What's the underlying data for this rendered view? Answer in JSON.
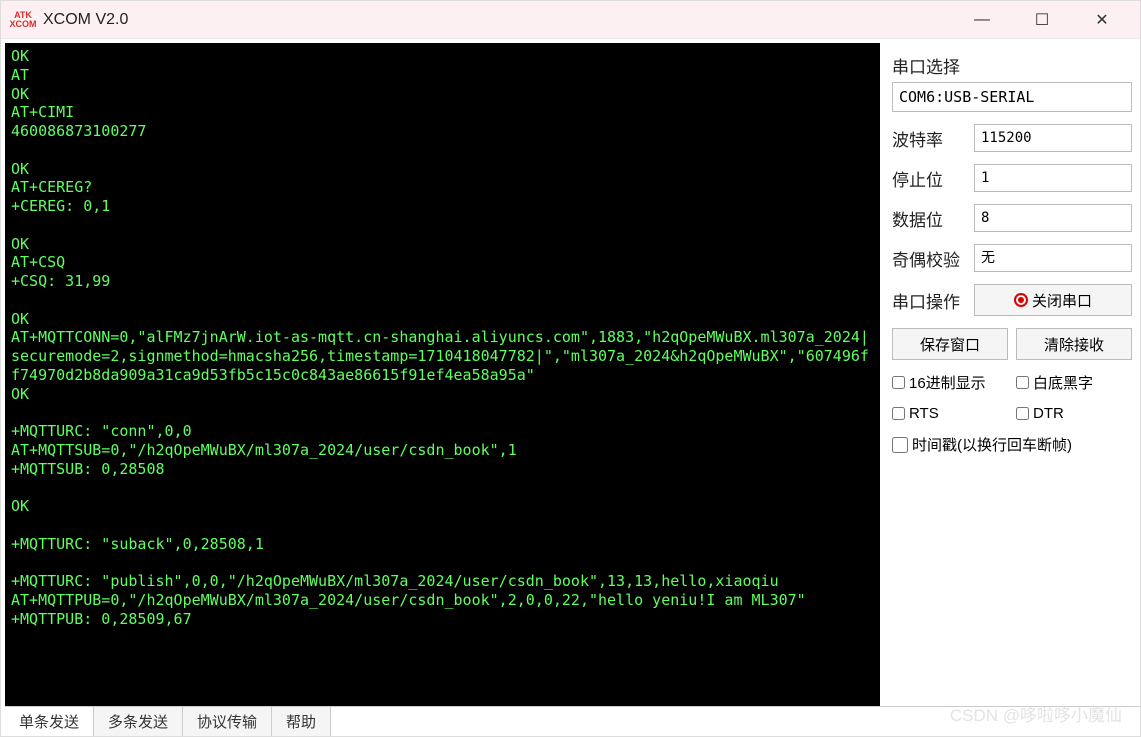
{
  "window": {
    "title": "XCOM V2.0",
    "icon_label": "ATK XCOM"
  },
  "terminal_lines": [
    "OK",
    "AT",
    "OK",
    "AT+CIMI",
    "460086873100277",
    "",
    "OK",
    "AT+CEREG?",
    "+CEREG: 0,1",
    "",
    "OK",
    "AT+CSQ",
    "+CSQ: 31,99",
    "",
    "OK",
    "AT+MQTTCONN=0,\"alFMz7jnArW.iot-as-mqtt.cn-shanghai.aliyuncs.com\",1883,\"h2qOpeMWuBX.ml307a_2024|securemode=2,signmethod=hmacsha256,timestamp=1710418047782|\",\"ml307a_2024&h2qOpeMWuBX\",\"607496ff74970d2b8da909a31ca9d53fb5c15c0c843ae86615f91ef4ea58a95a\"",
    "OK",
    "",
    "+MQTTURC: \"conn\",0,0",
    "AT+MQTTSUB=0,\"/h2qOpeMWuBX/ml307a_2024/user/csdn_book\",1",
    "+MQTTSUB: 0,28508",
    "",
    "OK",
    "",
    "+MQTTURC: \"suback\",0,28508,1",
    "",
    "+MQTTURC: \"publish\",0,0,\"/h2qOpeMWuBX/ml307a_2024/user/csdn_book\",13,13,hello,xiaoqiu",
    "AT+MQTTPUB=0,\"/h2qOpeMWuBX/ml307a_2024/user/csdn_book\",2,0,0,22,\"hello yeniu!I am ML307\"",
    "+MQTTPUB: 0,28509,67",
    ""
  ],
  "panel": {
    "port_section_title": "串口选择",
    "port_value": "COM6:USB-SERIAL",
    "baud_label": "波特率",
    "baud_value": "115200",
    "stop_label": "停止位",
    "stop_value": "1",
    "data_label": "数据位",
    "data_value": "8",
    "parity_label": "奇偶校验",
    "parity_value": "无",
    "op_label": "串口操作",
    "op_button": "关闭串口",
    "save_btn": "保存窗口",
    "clear_btn": "清除接收",
    "hex_display": "16进制显示",
    "white_bg": "白底黑字",
    "rts": "RTS",
    "dtr": "DTR",
    "timestamp": "时间戳(以换行回车断帧)"
  },
  "tabs": [
    {
      "label": "单条发送",
      "active": true
    },
    {
      "label": "多条发送",
      "active": false
    },
    {
      "label": "协议传输",
      "active": false
    },
    {
      "label": "帮助",
      "active": false
    }
  ],
  "watermark": "CSDN @哆啦哆小魔仙"
}
